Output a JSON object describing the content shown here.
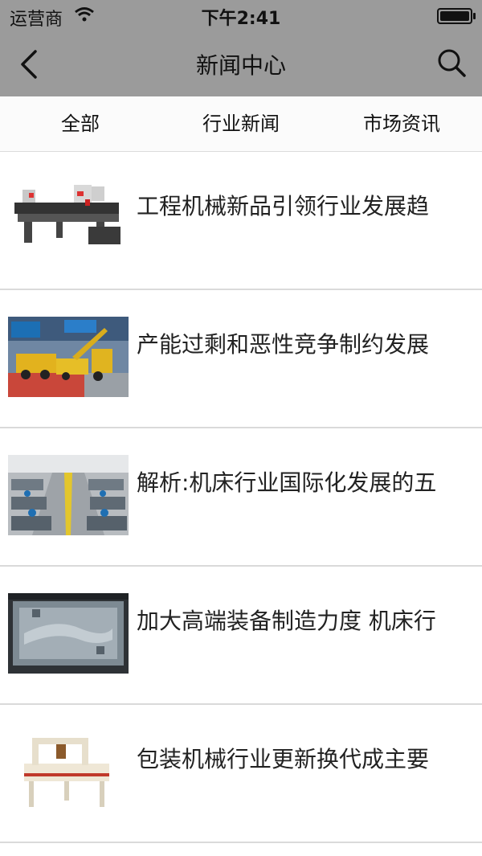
{
  "status_bar": {
    "carrier": "运营商",
    "time": "下午2:41"
  },
  "nav": {
    "title": "新闻中心",
    "back_icon": "chevron-left-icon",
    "search_icon": "search-icon"
  },
  "tabs": [
    {
      "label": "全部"
    },
    {
      "label": "行业新闻"
    },
    {
      "label": "市场资讯"
    }
  ],
  "news": [
    {
      "title": "工程机械新品引领行业发展趋",
      "image": "machine-saw-image"
    },
    {
      "title": "产能过剩和恶性竞争制约发展",
      "image": "expo-hall-image"
    },
    {
      "title": "解析:机床行业国际化发展的五",
      "image": "factory-floor-image"
    },
    {
      "title": "加大高端装备制造力度 机床行",
      "image": "mold-image"
    },
    {
      "title": "包装机械行业更新换代成主要",
      "image": "packaging-machine-image"
    }
  ],
  "colors": {
    "header_bg": "#9b9b9b",
    "tab_bg": "#fbfbfb",
    "divider": "#dadada"
  }
}
